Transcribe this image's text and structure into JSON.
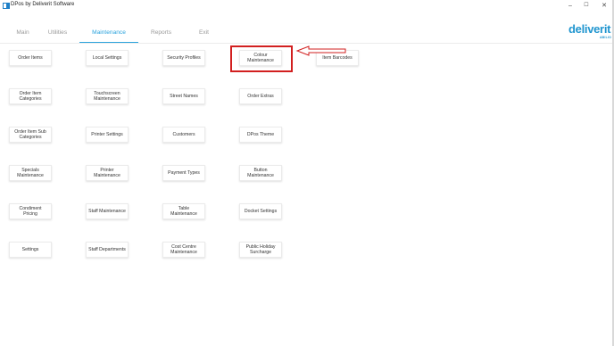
{
  "window": {
    "title": "DPos by Deliverit Software",
    "icon": "dpos-app-icon",
    "controls": {
      "minimize": "–",
      "maximize": "☐",
      "close": "✕"
    }
  },
  "tabs": [
    {
      "label": "Main",
      "active": false
    },
    {
      "label": "Utilities",
      "active": false
    },
    {
      "label": "Maintenance",
      "active": true
    },
    {
      "label": "Reports",
      "active": false
    },
    {
      "label": "Exit",
      "active": false
    }
  ],
  "brand": {
    "name": "deliverit",
    "sub": "ABILIO",
    "color": "#1f95cf"
  },
  "accent_color": "#2ba3dd",
  "highlight_color": "#d21f1f",
  "grid": [
    [
      "Order Items",
      "Local Settings",
      "Security Profiles",
      "Colour Maintenance",
      "Item Barcodes"
    ],
    [
      "Order Item Categories",
      "Touchscreen Maintenance",
      "Street Names",
      "Order Extras"
    ],
    [
      "Order Item Sub Categories",
      "Printer Settings",
      "Customers",
      "DPos Theme"
    ],
    [
      "Specials Maintenance",
      "Printer Maintenance",
      "Payment Types",
      "Button Maintenance"
    ],
    [
      "Condiment Pricing",
      "Staff Maintenance",
      "Table Maintenance",
      "Docket Settings"
    ],
    [
      "Settings",
      "Staff Departments",
      "Cost Centre Maintenance",
      "Public Holiday Surcharge"
    ]
  ],
  "highlighted_item": "Colour Maintenance"
}
